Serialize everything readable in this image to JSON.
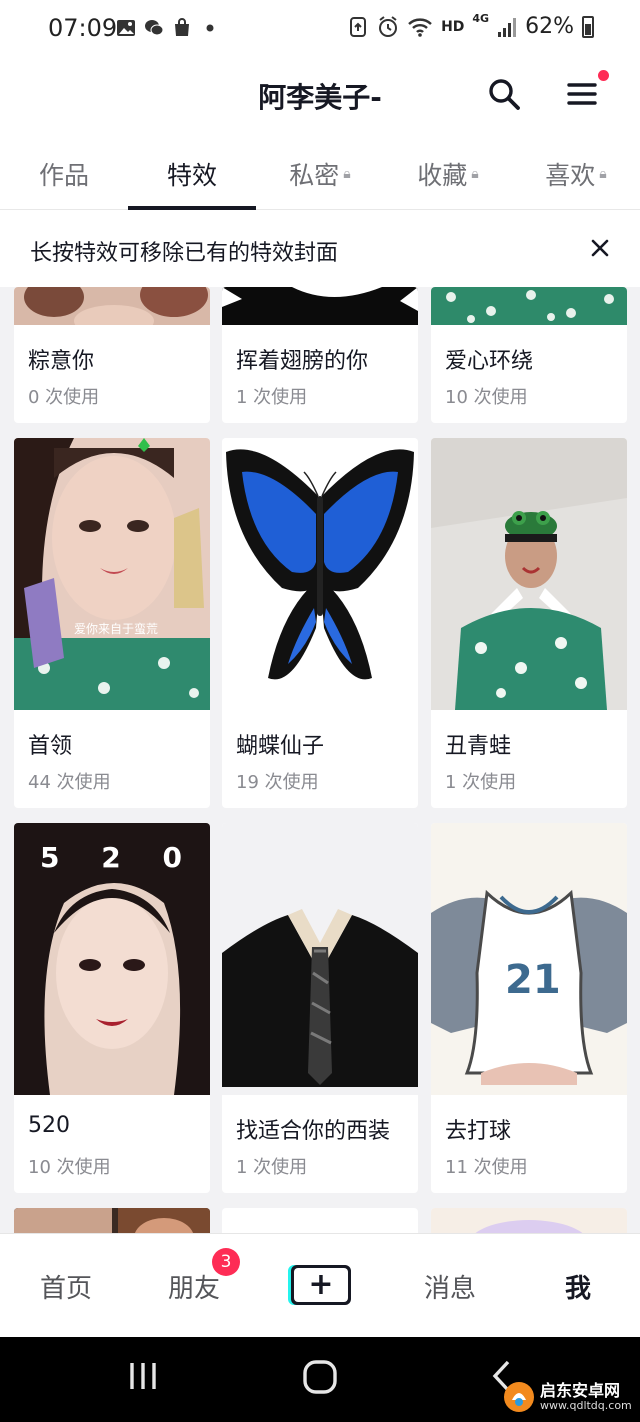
{
  "status_bar": {
    "time": "07:09",
    "network": "HD",
    "signal_type": "4G",
    "battery": "62%"
  },
  "header": {
    "title": "阿李美子-"
  },
  "tabs": [
    {
      "label": "作品",
      "locked": false,
      "active": false
    },
    {
      "label": "特效",
      "locked": false,
      "active": true
    },
    {
      "label": "私密",
      "locked": true,
      "active": false
    },
    {
      "label": "收藏",
      "locked": true,
      "active": false
    },
    {
      "label": "喜欢",
      "locked": true,
      "active": false
    }
  ],
  "notice": {
    "text": "长按特效可移除已有的特效封面"
  },
  "effects": [
    {
      "name": "粽意你",
      "uses": "0 次使用"
    },
    {
      "name": "挥着翅膀的你",
      "uses": "1 次使用"
    },
    {
      "name": "爱心环绕",
      "uses": "10 次使用"
    },
    {
      "name": "首领",
      "uses": "44 次使用",
      "overlay_text": "爱你来自于蛮荒"
    },
    {
      "name": "蝴蝶仙子",
      "uses": "19 次使用"
    },
    {
      "name": "丑青蛙",
      "uses": "1 次使用"
    },
    {
      "name": "520",
      "uses": "10 次使用",
      "overlay_text": "5 2 0"
    },
    {
      "name": "找适合你的西装",
      "uses": "1 次使用"
    },
    {
      "name": "去打球",
      "uses": "11 次使用",
      "overlay_text": "21"
    }
  ],
  "bottom_nav": {
    "items": [
      "首页",
      "朋友",
      "消息",
      "我"
    ],
    "friends_badge": "3",
    "plus_label": "+"
  },
  "watermark": {
    "name": "启东安卓网",
    "url": "www.qdltdq.com"
  },
  "colors": {
    "accent": "#fe2c55",
    "text": "#161823",
    "muted": "#8a8b91",
    "grid_bg": "#f2f2f4"
  }
}
